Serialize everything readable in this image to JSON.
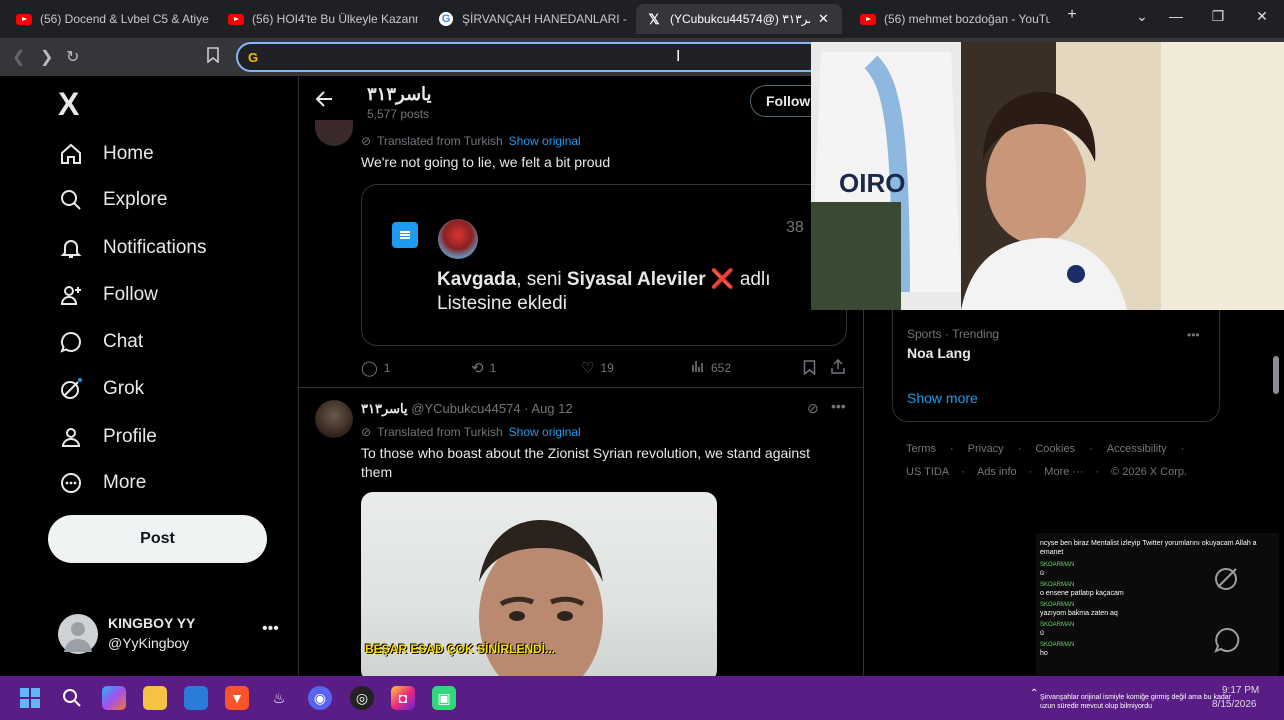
{
  "browser": {
    "tabs": [
      {
        "title": "(56) Docend & Lvbel C5 & Atiye",
        "icon": "youtube-icon"
      },
      {
        "title": "(56) HOI4'te Bu Ülkeyle Kazanma",
        "icon": "youtube-icon"
      },
      {
        "title": "ŞİRVANÇAH HANEDANLARI - Go",
        "icon": "google-icon"
      },
      {
        "title": "(YCubukcu44574@) یاسر۳۱۳",
        "icon": "x-icon"
      },
      {
        "title": "(56) mehmet bozdoğan - YouTub",
        "icon": "youtube-icon"
      }
    ],
    "new_tab": "+",
    "address_value": ""
  },
  "sidebar": {
    "logo": "X",
    "items": [
      {
        "label": "Home"
      },
      {
        "label": "Explore"
      },
      {
        "label": "Notifications"
      },
      {
        "label": "Follow"
      },
      {
        "label": "Chat"
      },
      {
        "label": "Grok"
      },
      {
        "label": "Profile"
      },
      {
        "label": "More"
      }
    ],
    "post_button": "Post",
    "account": {
      "name": "KINGBOY YY",
      "handle": "@YyKingboy"
    }
  },
  "profile_header": {
    "name": "یاسر۳۱۳",
    "posts": "5,577 posts",
    "follow_button": "Followi"
  },
  "tweet1": {
    "translated": "Translated from Turkish",
    "show_original": "Show original",
    "text": "We're not going to lie, we felt a bit proud",
    "embed_count": "38",
    "embed_text_parts": [
      "Kavgada",
      ", seni ",
      "Siyasal Aleviler",
      " ❌ adlı"
    ],
    "embed_text_line2": "Listesine ekledi",
    "replies": "1",
    "reposts": "1",
    "likes": "19",
    "views": "652"
  },
  "tweet2": {
    "name": "یاسر۳۱۳",
    "handle": "@YCubukcu44574",
    "date": "· Aug 12",
    "translated": "Translated from Turkish",
    "show_original": "Show original",
    "text": "To those who boast about the Zionist Syrian revolution, we stand against them",
    "image_caption": "BEŞAR ESAD ÇOK SİNİRLENDİ..."
  },
  "trending": {
    "category": "Sports · Trending",
    "topic": "Noa Lang",
    "show_more": "Show more"
  },
  "footer_links": {
    "row1": [
      "Terms",
      "Privacy",
      "Cookies",
      "Accessibility"
    ],
    "row2": [
      "US TIDA",
      "Ads info",
      "More ···",
      "© 2026 X Corp."
    ]
  },
  "stream_chat": {
    "header": "ncyse ben biraz Mentalist izleyip Twitter yorumlarını okuyacam Allah a emanet",
    "messages": [
      {
        "user": "SKOARMAN",
        "text": "ü"
      },
      {
        "user": "SKOARMAN",
        "text": "o ensene patlatıp kaçacam"
      },
      {
        "user": "SKOARMAN",
        "text": "yazıyom bakma zaten aq"
      },
      {
        "user": "SKOARMAN",
        "text": "ü"
      },
      {
        "user": "SKOARMAN",
        "text": "ho"
      }
    ],
    "ticker": "Şirvanşahlar orijinal ismiyle komiğe girmiş değil ama bu kadar uzun süredir mevcut olup bilmiyordu"
  },
  "system": {
    "time": "9:17 PM",
    "date": "8/15/2026"
  },
  "colors": {
    "accent": "#1d9bf0",
    "taskbar": "#5a1d86"
  }
}
